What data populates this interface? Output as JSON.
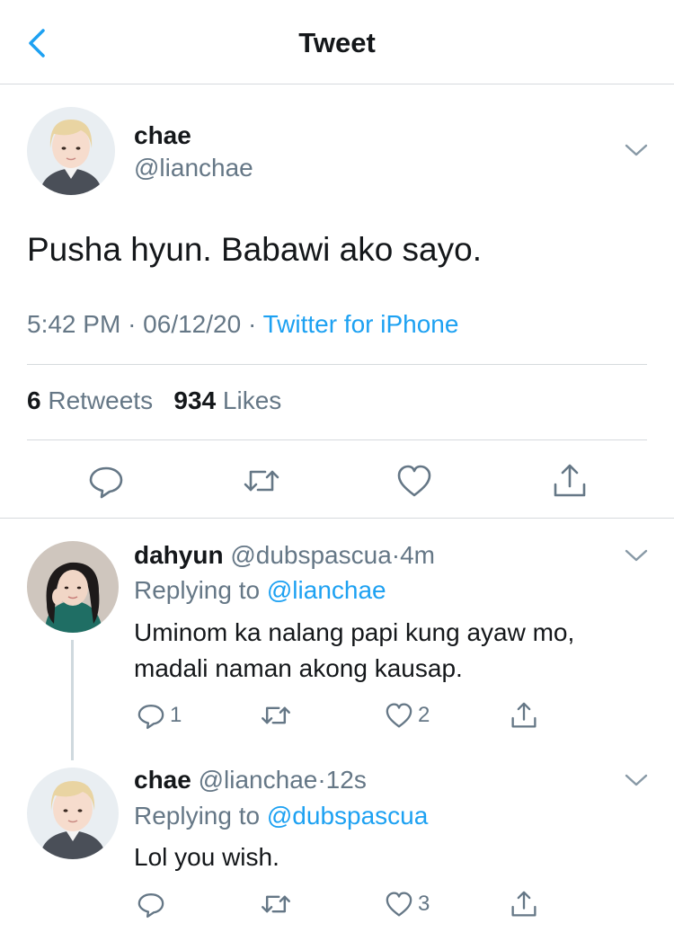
{
  "header": {
    "title": "Tweet"
  },
  "colors": {
    "accent": "#1da1f2",
    "secondary_text": "#657786",
    "primary_text": "#14171a",
    "divider": "#d6dadd"
  },
  "main_tweet": {
    "name": "chae",
    "handle": "@lianchae",
    "text": "Pusha hyun. Babawi ako sayo.",
    "time": "5:42 PM",
    "date": "06/12/20",
    "source": "Twitter for iPhone",
    "retweets_count": "6",
    "retweets_label": "Retweets",
    "likes_count": "934",
    "likes_label": "Likes",
    "icons": [
      "reply-icon",
      "retweet-icon",
      "like-icon",
      "share-icon"
    ]
  },
  "replies": [
    {
      "name": "dahyun",
      "handle": "@dubspascua",
      "time": "4m",
      "replying_label": "Replying to",
      "replying_to": "@lianchae",
      "text_lines": [
        "Uminom ka nalang papi kung ayaw mo,",
        "madali naman akong kausap."
      ],
      "reply_count": "1",
      "like_count": "2"
    },
    {
      "name": "chae",
      "handle": "@lianchae",
      "time": "12s",
      "replying_label": "Replying to",
      "replying_to": "@dubspascua",
      "text_lines": [
        "Lol you wish."
      ],
      "reply_count": "",
      "like_count": "3"
    }
  ],
  "separator": "·"
}
